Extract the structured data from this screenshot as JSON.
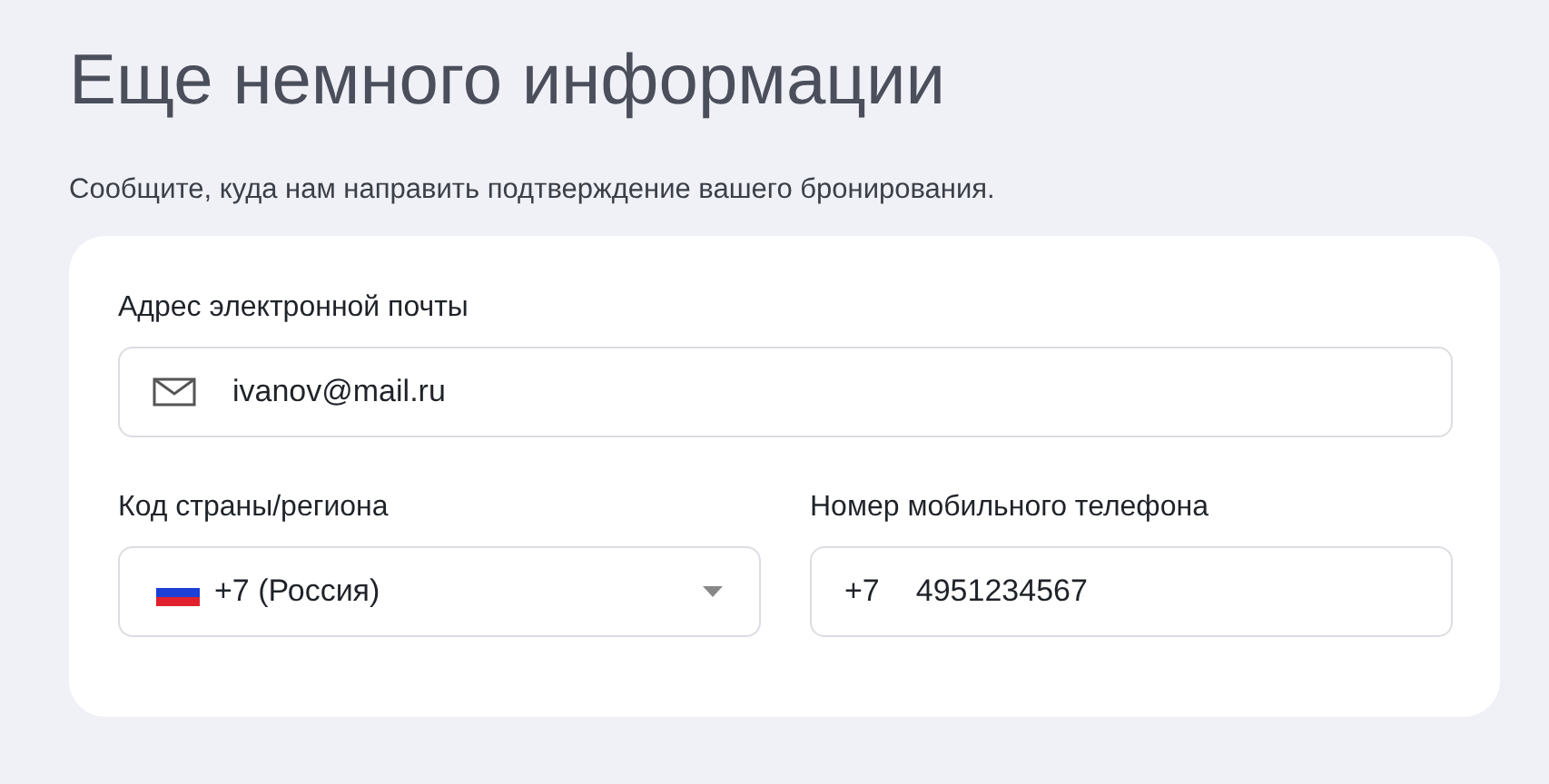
{
  "title": "Еще немного информации",
  "subtitle": "Сообщите, куда нам направить подтверждение вашего бронирования.",
  "email": {
    "label": "Адрес электронной почты",
    "value": "ivanov@mail.ru"
  },
  "country": {
    "label": "Код страны/региона",
    "value": "+7 (Россия)"
  },
  "phone": {
    "label": "Номер мобильного телефона",
    "prefix": "+7",
    "value": "4951234567"
  }
}
